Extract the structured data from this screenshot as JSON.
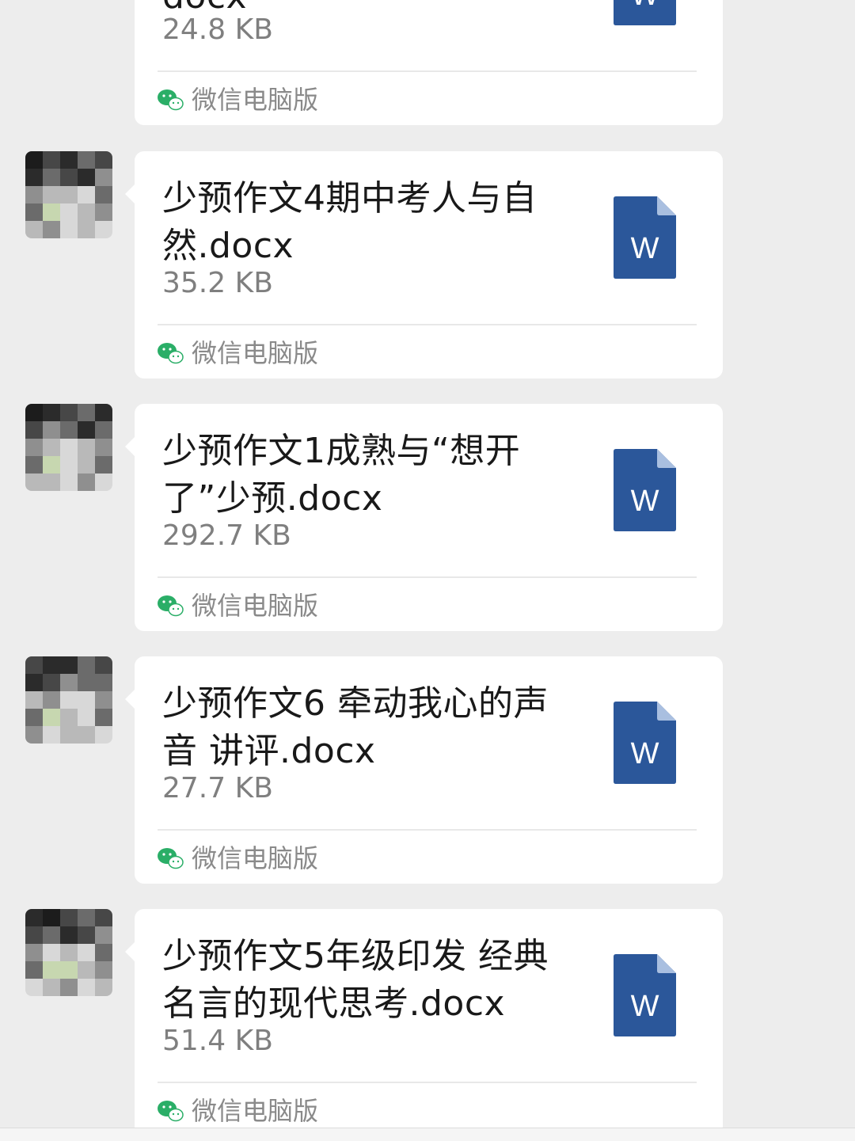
{
  "messages": [
    {
      "file_name": "docx",
      "file_size": "24.8 KB",
      "file_type_icon": "word-doc-icon",
      "source_label": "微信电脑版",
      "has_avatar": false
    },
    {
      "file_name": "少预作文4期中考人与自然.docx",
      "file_size": "35.2 KB",
      "file_type_icon": "word-doc-icon",
      "source_label": "微信电脑版",
      "has_avatar": true
    },
    {
      "file_name": "少预作文1成熟与“想开了”少预.docx",
      "file_size": "292.7 KB",
      "file_type_icon": "word-doc-icon",
      "source_label": "微信电脑版",
      "has_avatar": true
    },
    {
      "file_name": "少预作文6 牵动我心的声音 讲评.docx",
      "file_size": "27.7 KB",
      "file_type_icon": "word-doc-icon",
      "source_label": "微信电脑版",
      "has_avatar": true
    },
    {
      "file_name": "少预作文5年级印发 经典名言的现代思考.docx",
      "file_size": "51.4 KB",
      "file_type_icon": "word-doc-icon",
      "source_label": "微信电脑版",
      "has_avatar": true
    }
  ],
  "doc_icon": {
    "letter": "W",
    "color": "#2b579a",
    "fold_color": "#a9bfe0"
  },
  "wechat_icon_color": "#2aae67",
  "avatar_palette": [
    "#2b2b2b",
    "#474747",
    "#6b6b6b",
    "#8f8f8f",
    "#b9b9b9",
    "#d8d8d8",
    "#c7d7b0",
    "#1c1c1c"
  ]
}
